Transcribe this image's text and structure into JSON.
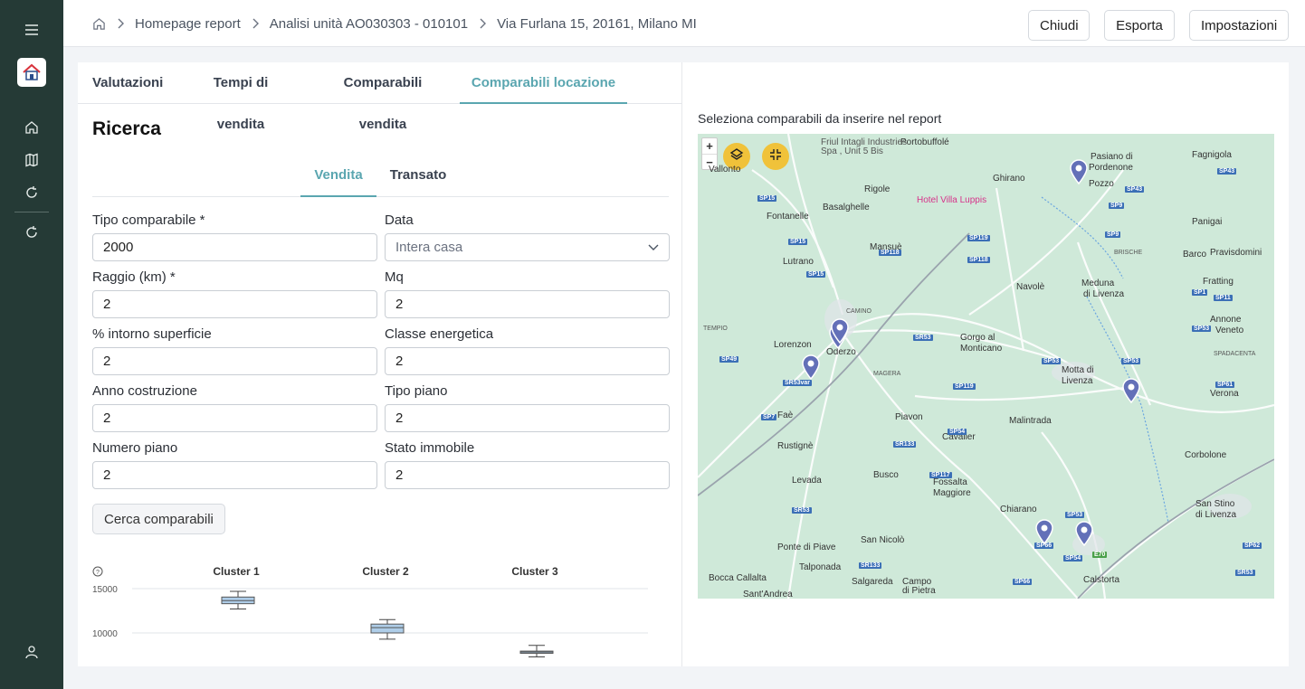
{
  "breadcrumb": {
    "home_icon": "home-icon",
    "items": [
      "Homepage report",
      "Analisi unità AO030303 - 010101",
      "Via Furlana 15, 20161, Milano MI"
    ]
  },
  "header_buttons": {
    "close": "Chiudi",
    "export": "Esporta",
    "settings": "Impostazioni"
  },
  "tabs": [
    "Valutazioni",
    "Tempi di vendita",
    "Comparabili vendita",
    "Comparabili locazione"
  ],
  "active_tab": "Comparabili locazione",
  "section_title": "Ricerca",
  "subtabs": [
    "Vendita",
    "Transato"
  ],
  "active_subtab": "Vendita",
  "form": {
    "tipo_comparabile": {
      "label": "Tipo comparabile *",
      "value": "2000"
    },
    "data": {
      "label": "Data",
      "placeholder": "Intera casa"
    },
    "raggio": {
      "label": "Raggio (km) *",
      "value": "2"
    },
    "mq": {
      "label": "Mq",
      "value": "2"
    },
    "intorno": {
      "label": "% intorno superficie",
      "value": "2"
    },
    "classe": {
      "label": "Classe energetica",
      "value": "2"
    },
    "anno": {
      "label": "Anno costruzione",
      "value": "2"
    },
    "tipo_piano": {
      "label": "Tipo piano",
      "value": "2"
    },
    "numero_piano": {
      "label": "Numero piano",
      "value": "2"
    },
    "stato": {
      "label": "Stato immobile",
      "value": "2"
    }
  },
  "search_button": "Cerca comparabili",
  "chart_data": {
    "type": "boxplot",
    "categories": [
      "Cluster 1",
      "Cluster 2",
      "Cluster 3"
    ],
    "yticks": [
      "15000",
      "10000"
    ],
    "boxes": [
      {
        "name": "Cluster 1",
        "min": 12700,
        "q1": 13300,
        "median": 13650,
        "q3": 14050,
        "max": 14700
      },
      {
        "name": "Cluster 2",
        "min": 9300,
        "q1": 10000,
        "median": 10600,
        "q3": 11000,
        "max": 11500
      },
      {
        "name": "Cluster 3",
        "min": 7300,
        "q1": 7700,
        "median": 7850,
        "q3": 7950,
        "max": 8600
      }
    ],
    "series_color": "#aecde8"
  },
  "map": {
    "title": "Seleziona comparabili da inserire nel report",
    "zoom_in": "+",
    "zoom_out": "−",
    "poi": [
      "Friul Intagli Industries",
      "Spa , Unit 5 Bis",
      "Hotel Villa Luppis"
    ],
    "places": [
      "Portobuffolé",
      "Vallonto",
      "Ghirano",
      "Pasiano di",
      "Pordenone",
      "Fagnigola",
      "Rigole",
      "Basalghelle",
      "Fontanelle",
      "Pozzo",
      "Panigai",
      "Mansuè",
      "Lutrano",
      "Barco",
      "Pravisdomini",
      "BRISCHE",
      "Meduna",
      "di Livenza",
      "Navolè",
      "Fratting",
      "Annone",
      "Veneto",
      "TEMPIO",
      "CAMINO",
      "Lorenzon",
      "Oderzo",
      "Gorgo al",
      "Monticano",
      "Motta di",
      "Livenza",
      "SPADACENTA",
      "MAGERA",
      "Verona",
      "Faè",
      "Piavon",
      "Malintrada",
      "Rustignè",
      "Cavalier",
      "Corbolone",
      "Busco",
      "Levada",
      "Fossalta",
      "Maggiore",
      "San Stino",
      "di Livenza",
      "Chiarano",
      "Ponte di Piave",
      "San Nicolò",
      "Talponada",
      "Calstorta",
      "Bocca Callalta",
      "Salgareda",
      "Campo",
      "di Pietra",
      "Sant'Andrea"
    ],
    "roads": [
      "SP15",
      "SP15",
      "SP15",
      "SP118",
      "SP118",
      "SP119",
      "SP43",
      "SP43",
      "SP9",
      "SP9",
      "SP1",
      "SP11",
      "SP53",
      "SR53",
      "SP53",
      "SP53",
      "SP49",
      "SR53var",
      "SP119",
      "SP61",
      "SP7",
      "SP54",
      "SR133",
      "SP117",
      "SR53",
      "SP53",
      "SP54",
      "SP66",
      "SR133",
      "SP66",
      "SP66",
      "SP514",
      "SP62",
      "SR53",
      "E70",
      "E70"
    ],
    "colors": {
      "land": "#cfe9d9",
      "water": "#6ba6e0",
      "road": "#ffffff",
      "marker": "#6370b8"
    }
  }
}
